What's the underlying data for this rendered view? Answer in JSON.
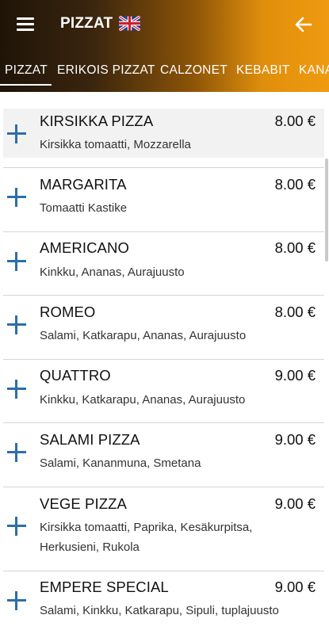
{
  "header": {
    "title": "PIZZAT",
    "language_flag_icon": "uk-flag-icon",
    "menu_icon": "hamburger-menu-icon",
    "back_icon": "arrow-left-icon"
  },
  "tabs": [
    {
      "label": "PIZZAT",
      "active": true
    },
    {
      "label": "ERIKOIS PIZZAT"
    },
    {
      "label": "CALZONET"
    },
    {
      "label": "KEBABIT"
    },
    {
      "label": "KANA"
    }
  ],
  "items": [
    {
      "name": "KIRSIKKA PIZZA",
      "price": "8.00 €",
      "desc": "Kirsikka tomaatti, Mozzarella"
    },
    {
      "name": "MARGARITA",
      "price": "8.00 €",
      "desc": "Tomaatti Kastike"
    },
    {
      "name": "AMERICANO",
      "price": "8.00 €",
      "desc": "Kinkku, Ananas, Aurajuusto"
    },
    {
      "name": "ROMEO",
      "price": "8.00 €",
      "desc": "Salami, Katkarapu, Ananas, Aurajuusto"
    },
    {
      "name": "QUATTRO",
      "price": "9.00 €",
      "desc": "Kinkku, Katkarapu, Ananas, Aurajuusto"
    },
    {
      "name": "SALAMI PIZZA",
      "price": "9.00 €",
      "desc": "Salami, Kananmuna, Smetana"
    },
    {
      "name": "VEGE PIZZA",
      "price": "9.00 €",
      "desc": "Kirsikka tomaatti, Paprika, Kesäkurpitsa, Herkusieni, Rukola"
    },
    {
      "name": "EMPERE SPECIAL",
      "price": "9.00 €",
      "desc": "Salami, Kinkku, Katkarapu, Sipuli, tuplajuusto"
    }
  ],
  "colors": {
    "accent_plus": "#2d6ea8",
    "header_dark": "#1f1408",
    "header_orange": "#f09a10"
  }
}
